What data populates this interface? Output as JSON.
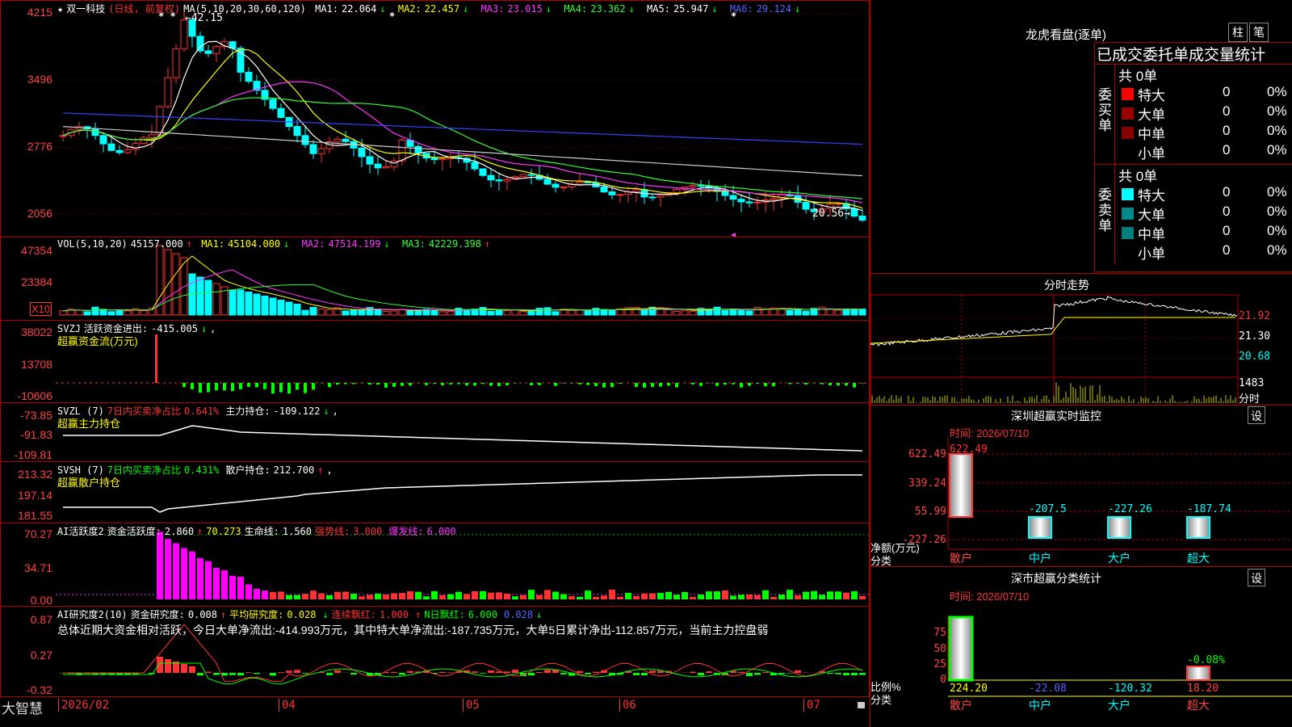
{
  "stock": {
    "name": "双一科技",
    "mode": "(日线, 前复权)",
    "star": "★"
  },
  "main": {
    "yticks": [
      "4215",
      "3496",
      "2776",
      "2056"
    ],
    "ma_params": "MA(5,10,20,30,60,120)",
    "ma": [
      {
        "label": "MA1:",
        "value": "22.064",
        "arrow": "↓"
      },
      {
        "label": "MA2:",
        "value": "22.457",
        "arrow": "↓"
      },
      {
        "label": "MA3:",
        "value": "23.015",
        "arrow": "↓"
      },
      {
        "label": "MA4:",
        "value": "23.362",
        "arrow": "↓"
      },
      {
        "label": "MA5:",
        "value": "25.947",
        "arrow": "↓"
      },
      {
        "label": "MA6:",
        "value": "29.124",
        "arrow": "↓"
      }
    ],
    "high_label": "42.15",
    "low_label": "20.56",
    "star_marks": "* *",
    "star2": "*",
    "star3": "*"
  },
  "vol": {
    "title": "VOL(5,10,20)",
    "value": "45157.000",
    "arrow": "↑",
    "ma": [
      {
        "label": "MA1:",
        "value": "45104.000",
        "arrow": "↓"
      },
      {
        "label": "MA2:",
        "value": "47514.199",
        "arrow": "↓"
      },
      {
        "label": "MA3:",
        "value": "42229.398",
        "arrow": "↑"
      }
    ],
    "yticks": [
      "47354",
      "23384"
    ],
    "scale": "X10"
  },
  "svzj": {
    "title": "SVZJ",
    "desc": "活跃资金进出:",
    "value": "-415.005",
    "arrow": "↓",
    "sub": "超赢资金流(万元)",
    "yticks": [
      "38022",
      "13708",
      "-10606"
    ]
  },
  "svzl": {
    "title": "SVZL (7)",
    "desc": "7日内买卖净占比",
    "pct": "0.641%",
    "label": "主力持仓:",
    "value": "-109.122",
    "arrow": "↓",
    "sub": "超赢主力持仓",
    "yticks": [
      "-73.85",
      "-91.83",
      "-109.81"
    ]
  },
  "svsh": {
    "title": "SVSH (7)",
    "desc": "7日内买卖净占比",
    "pct": "0.431%",
    "label": "散户持仓:",
    "value": "212.700",
    "arrow": "↑",
    "sub": "超赢散户持仓",
    "yticks": [
      "213.32",
      "197.14",
      "181.55"
    ]
  },
  "ai1": {
    "title": "AI活跃度2",
    "label": "资金活跃度:",
    "value": "2.860",
    "arrow": "↑",
    "v2": "70.273",
    "l3": "生命线:",
    "v3": "1.560",
    "l4": "强势线:",
    "v4": "3.000",
    "l5": "爆发线:",
    "v5": "6.000",
    "yticks": [
      "70.27",
      "34.71",
      "0.00"
    ]
  },
  "ai2": {
    "title": "AI研究度2(10)",
    "label": "资金研究度:",
    "value": "0.008",
    "arrow": "↑",
    "l2": "平均研究度:",
    "v2": "0.028",
    "a2": "↓",
    "l3": "连续飘红:",
    "v3": "1.000",
    "a3": "↑",
    "l4": "N日飘红:",
    "v4": "6.000",
    "v5": "0.028",
    "a5": "↓",
    "summary": "总体近期大资金相对活跃，今日大单净流出:-414.993万元，其中特大单净流出:-187.735万元，大单5日累计净出-112.857万元，当前主力控盘弱",
    "yticks": [
      "0.87",
      "0.27",
      "-0.32"
    ]
  },
  "xaxis": {
    "brand": "大智慧",
    "labels": [
      "2026/02",
      "04",
      "05",
      "06",
      "07"
    ]
  },
  "right": {
    "lhb_title": "龙虎看盘(逐单)",
    "btn_zhu": "柱",
    "btn_bi": "笔",
    "entrust_title": "已成交委托单成交量统计",
    "buy": {
      "label": "委买单",
      "total": "共 0单",
      "rows": [
        {
          "name": "特大",
          "count": "0",
          "pct": "0%",
          "color": "#ff0000"
        },
        {
          "name": "大单",
          "count": "0",
          "pct": "0%",
          "color": "#990000"
        },
        {
          "name": "中单",
          "count": "0",
          "pct": "0%",
          "color": "#880000"
        },
        {
          "name": "小单",
          "count": "0",
          "pct": "0%",
          "color": "#000000"
        }
      ]
    },
    "sell": {
      "label": "委卖单",
      "total": "共 0单",
      "rows": [
        {
          "name": "特大",
          "count": "0",
          "pct": "0%",
          "color": "#00ffff"
        },
        {
          "name": "大单",
          "count": "0",
          "pct": "0%",
          "color": "#008a8a"
        },
        {
          "name": "中单",
          "count": "0",
          "pct": "0%",
          "color": "#008080"
        },
        {
          "name": "小单",
          "count": "0",
          "pct": "0%",
          "color": "#000000"
        }
      ]
    },
    "fs_title": "分时走势",
    "fs_prices": [
      "21.92",
      "21.30",
      "20.68"
    ],
    "fs_vol": "1483",
    "fs_vol_unit": "分时",
    "mon_title": "深圳超赢实时监控",
    "btn_set": "设",
    "mon_time": "时间: 2026/07/10",
    "mon_yticks": [
      "622.49",
      "339.24",
      "55.99",
      "-227.26"
    ],
    "mon_vals": [
      "622.49",
      "-207.5",
      "-227.26",
      "-187.74"
    ],
    "mon_ylabel": "净额(万元)",
    "mon_xlabel": "分类",
    "cats": [
      "散户",
      "中户",
      "大户",
      "超大"
    ],
    "cls_title": "深市超赢分类统计",
    "cls_time": "时间: 2026/07/10",
    "cls_yticks": [
      "75",
      "50",
      "25",
      "0"
    ],
    "cls_top": "-0.08%",
    "cls_vals": [
      "224.20",
      "-22.08",
      "-120.32",
      "18.20"
    ],
    "cls_ylabel": "比例%",
    "cls_xlabel": "分类"
  }
}
